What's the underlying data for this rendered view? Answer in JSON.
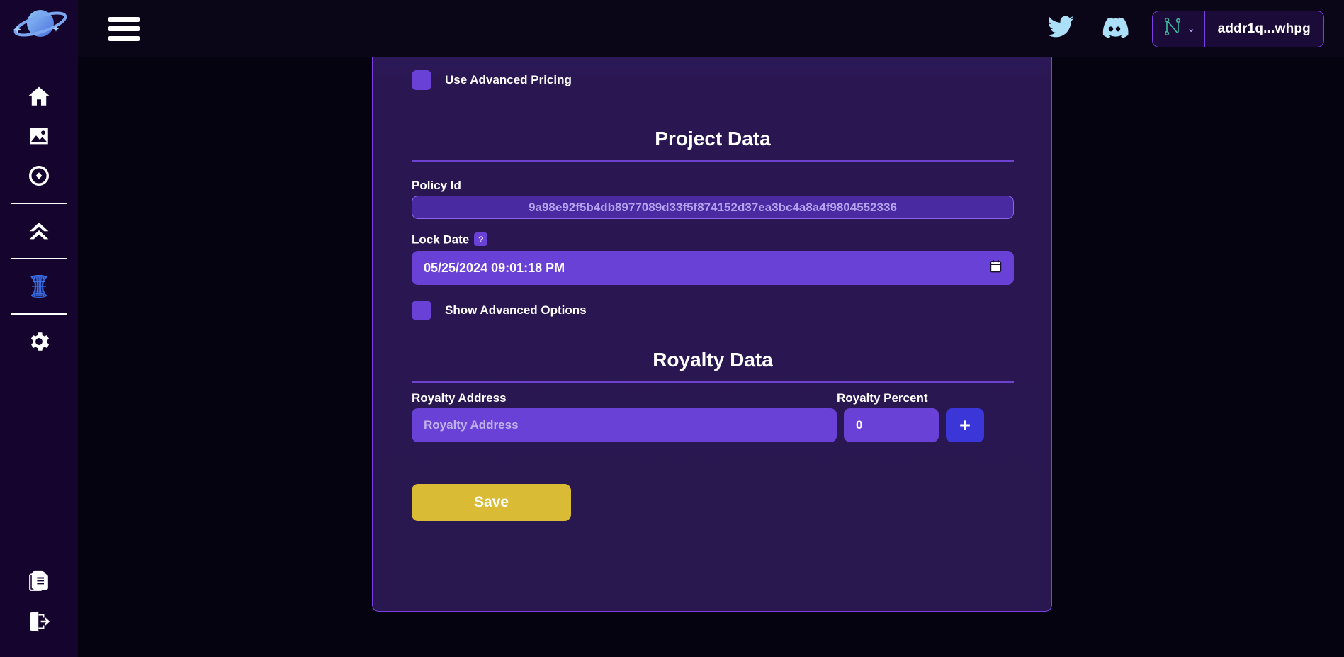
{
  "sidebar": {
    "logo_icon": "planet-logo-icon",
    "items": [
      {
        "icon": "home-icon",
        "name": "sidebar-item-home"
      },
      {
        "icon": "gallery-icon",
        "name": "sidebar-item-gallery"
      },
      {
        "icon": "token-icon",
        "name": "sidebar-item-token"
      },
      {
        "icon": "chevrons-up-icon",
        "name": "sidebar-item-mint"
      },
      {
        "icon": "portal-icon",
        "name": "sidebar-item-portal"
      },
      {
        "icon": "gear-icon",
        "name": "sidebar-item-settings"
      }
    ],
    "bottom_items": [
      {
        "icon": "documents-icon",
        "name": "sidebar-item-docs"
      },
      {
        "icon": "logout-icon",
        "name": "sidebar-item-logout"
      }
    ]
  },
  "header": {
    "menu_icon": "hamburger-menu-icon",
    "twitter_icon": "twitter-icon",
    "discord_icon": "discord-icon",
    "wallet": {
      "provider_icon": "nami-wallet-icon",
      "chevron": "⌄",
      "address": "addr1q...whpg"
    }
  },
  "form": {
    "advanced_pricing": {
      "label": "Use Advanced Pricing",
      "checked": false
    },
    "project_data": {
      "title": "Project Data",
      "policy_id_label": "Policy Id",
      "policy_id_value": "9a98e92f5b4db8977089d33f5f874152d37ea3bc4a8a4f9804552336",
      "lock_date_label": "Lock Date",
      "lock_date_help": "?",
      "lock_date_value": "05/25/2024 09:01:18 PM",
      "calendar_icon": "calendar-icon",
      "show_advanced_label": "Show Advanced Options",
      "show_advanced_checked": false
    },
    "royalty_data": {
      "title": "Royalty Data",
      "address_label": "Royalty Address",
      "address_placeholder": "Royalty Address",
      "address_value": "",
      "percent_label": "Royalty Percent",
      "percent_value": "0",
      "add_button_label": "+"
    },
    "save_label": "Save"
  },
  "colors": {
    "page_bg": "#05030f",
    "sidebar_bg": "#15052e",
    "header_bg": "#0a0618",
    "card_bg": "#291750",
    "card_border": "#7b3fe4",
    "input_bg": "#6a41d6",
    "readonly_bg": "#4a2aa0",
    "accent_blue": "#3a36d8",
    "save_gold": "#d9bb36",
    "social_blue": "#ace0f9"
  }
}
